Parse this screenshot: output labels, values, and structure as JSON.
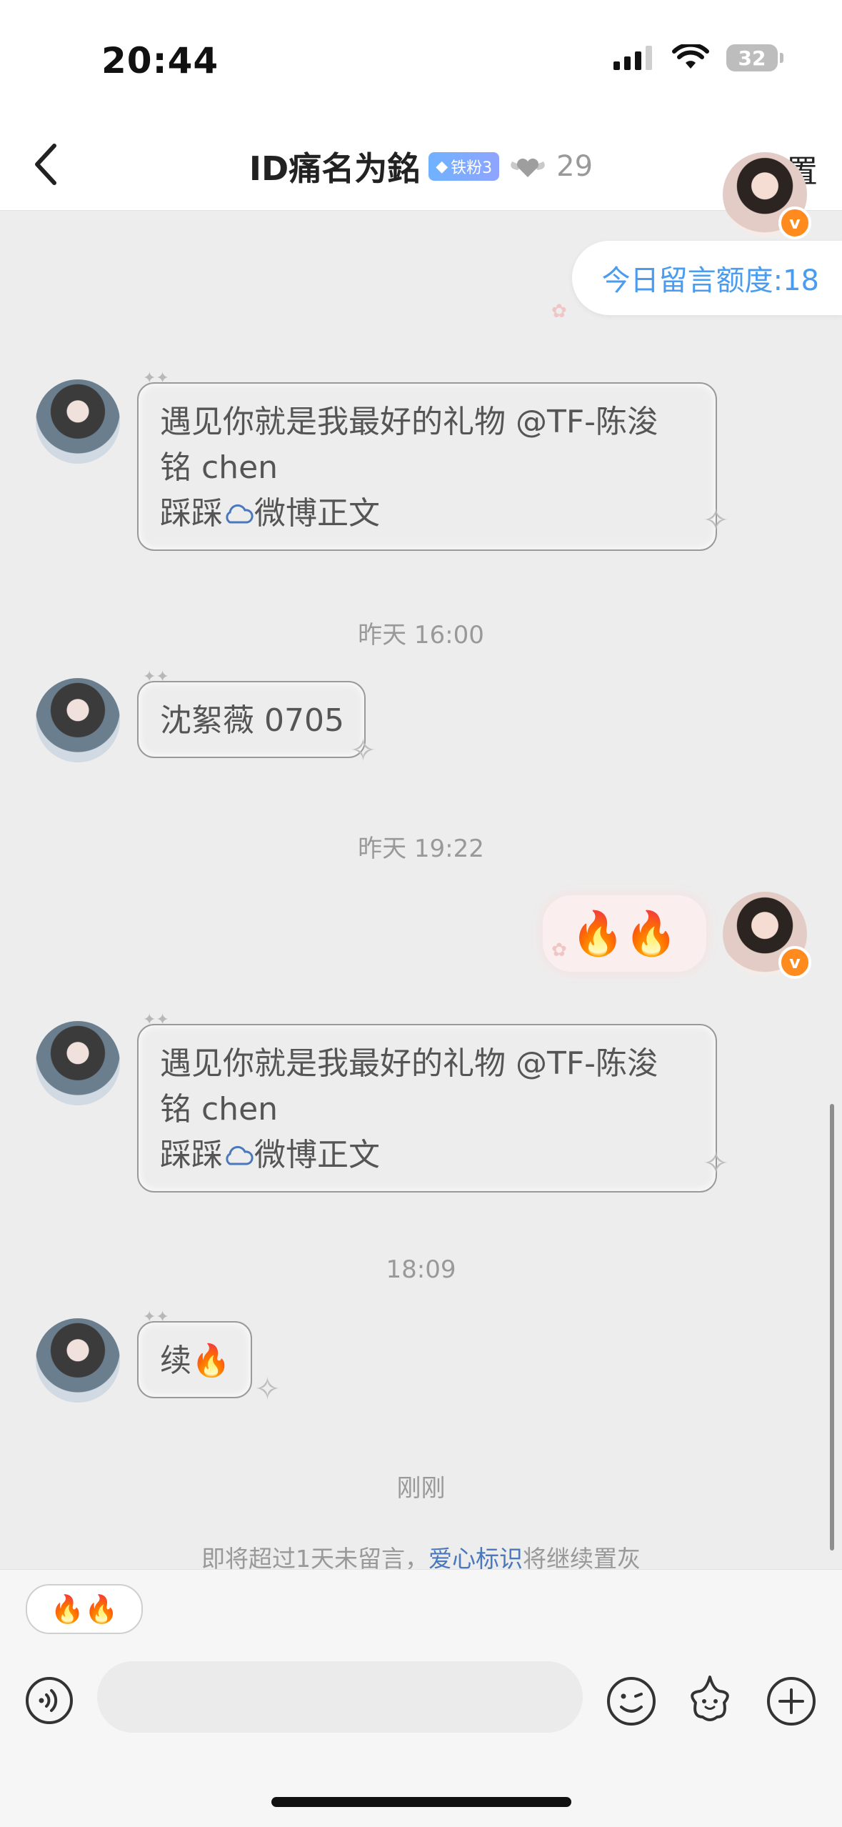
{
  "status_bar": {
    "time": "20:44",
    "battery": "32"
  },
  "nav": {
    "title": "ID痛名为銘",
    "fan_badge": "铁粉3",
    "fan_count": "29",
    "settings_label": "设置"
  },
  "quota_label": "今日留言额度:18",
  "timestamps": {
    "t1": "昨天 16:00",
    "t2": "昨天 19:22",
    "t3": "18:09",
    "t4": "刚刚"
  },
  "messages": {
    "m1": {
      "line1": "遇见你就是我最好的礼物 @TF-陈浚",
      "line2": "铭 chen",
      "line3_prefix": "踩踩",
      "line3_link": "微博正文"
    },
    "m2": {
      "text": "沈絮薇 0705"
    },
    "m3": {
      "text": "🔥🔥"
    },
    "m4": {
      "line1": "遇见你就是我最好的礼物 @TF-陈浚",
      "line2": "铭 chen",
      "line3_prefix": "踩踩",
      "line3_link": "微博正文"
    },
    "m5": {
      "text": "续🔥"
    }
  },
  "notice": {
    "before": "即将超过1天未留言，",
    "link": "爱心标识",
    "after": "将继续置灰"
  },
  "quick_reply": "🔥🔥",
  "input": {
    "placeholder": ""
  },
  "icons": {
    "back": "chevron-left-icon",
    "voice": "voice-icon",
    "emoji": "emoji-icon",
    "sticker": "star-sticker-icon",
    "plus": "plus-icon",
    "cloud": "cloud-icon"
  },
  "colors": {
    "accent": "#4a9cf0",
    "link": "#4a78bd",
    "badge": "#ff8a1d"
  }
}
